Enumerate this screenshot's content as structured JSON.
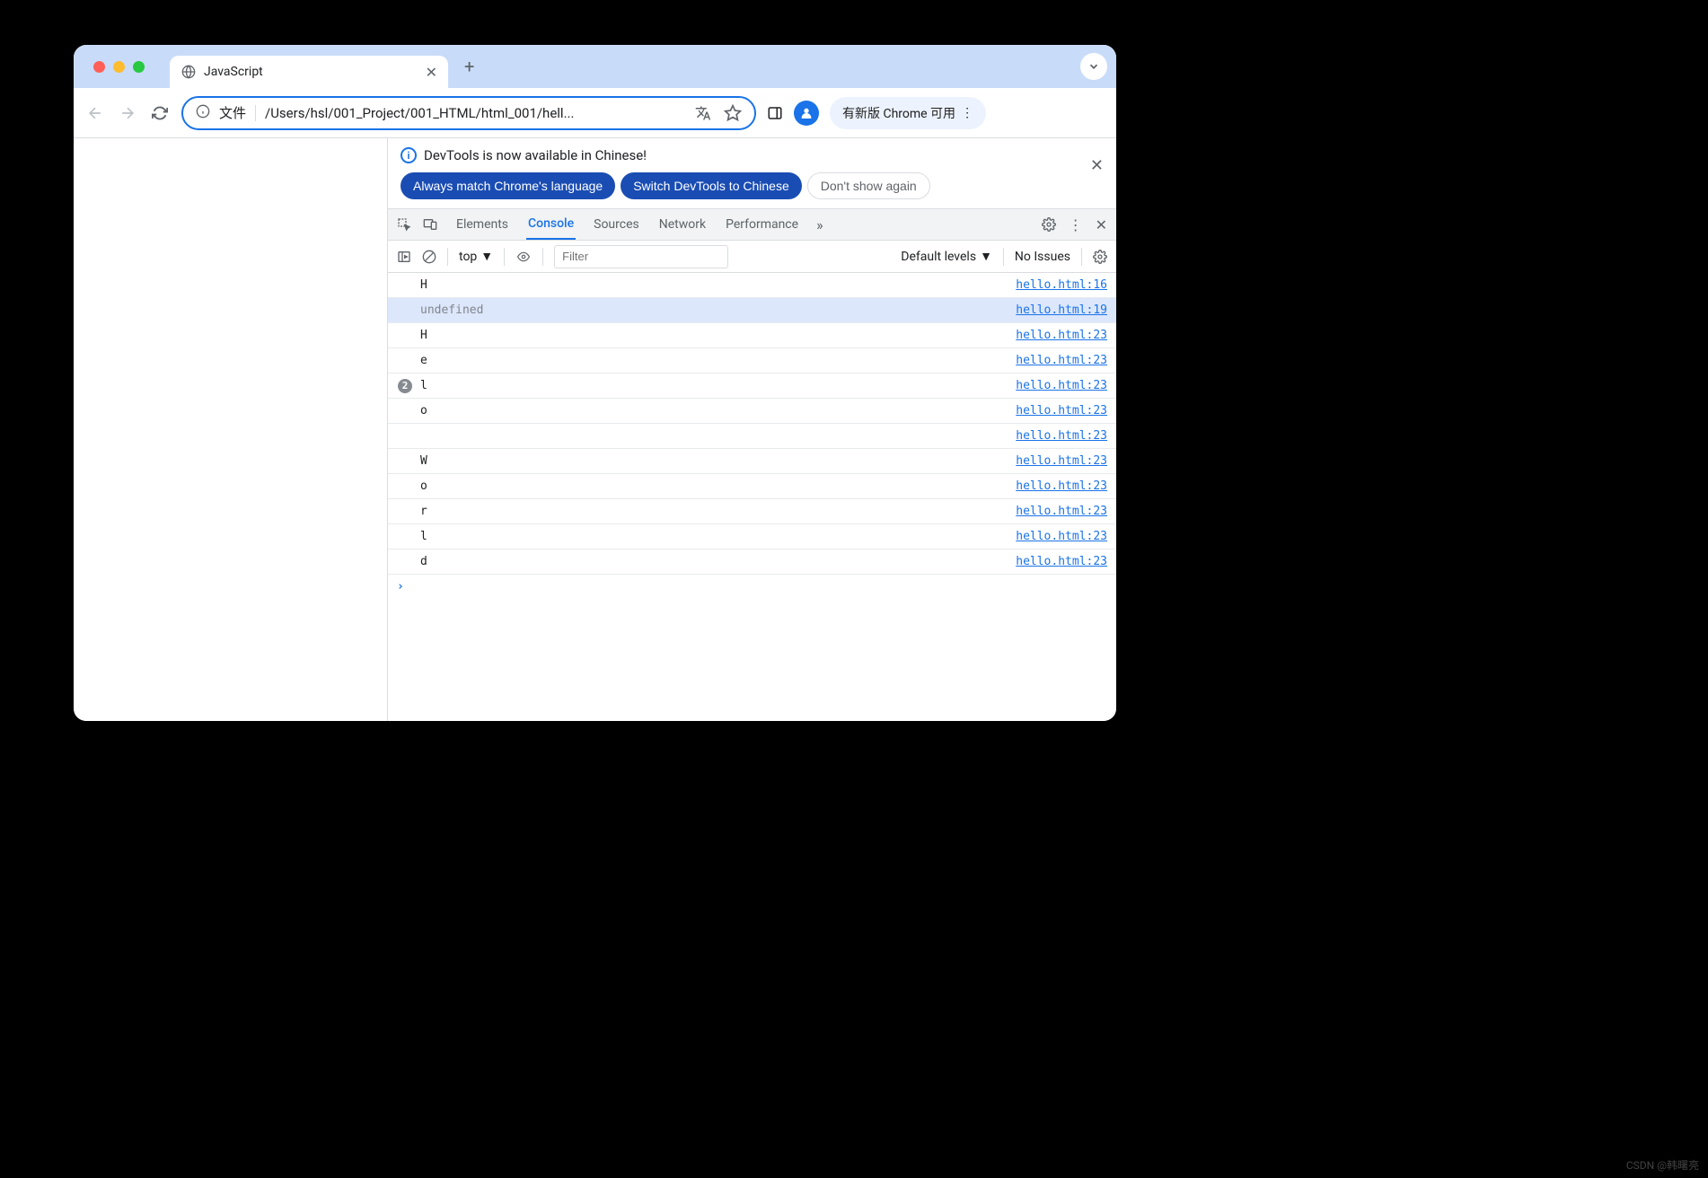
{
  "browser": {
    "tab_title": "JavaScript",
    "address": {
      "label": "文件",
      "url": "/Users/hsl/001_Project/001_HTML/html_001/hell..."
    },
    "update_label": "有新版 Chrome 可用"
  },
  "devtools": {
    "notification": {
      "text": "DevTools is now available in Chinese!",
      "btn_always": "Always match Chrome's language",
      "btn_switch": "Switch DevTools to Chinese",
      "btn_dont": "Don't show again"
    },
    "tabs": {
      "elements": "Elements",
      "console": "Console",
      "sources": "Sources",
      "network": "Network",
      "performance": "Performance"
    },
    "console_toolbar": {
      "context": "top",
      "filter_placeholder": "Filter",
      "levels": "Default levels",
      "issues": "No Issues"
    },
    "messages": [
      {
        "badge": "",
        "text": "H",
        "dim": false,
        "link": "hello.html:16",
        "hl": false
      },
      {
        "badge": "",
        "text": "undefined",
        "dim": true,
        "link": "hello.html:19",
        "hl": true
      },
      {
        "badge": "",
        "text": "H",
        "dim": false,
        "link": "hello.html:23",
        "hl": false
      },
      {
        "badge": "",
        "text": "e",
        "dim": false,
        "link": "hello.html:23",
        "hl": false
      },
      {
        "badge": "2",
        "text": "l",
        "dim": false,
        "link": "hello.html:23",
        "hl": false
      },
      {
        "badge": "",
        "text": "o",
        "dim": false,
        "link": "hello.html:23",
        "hl": false
      },
      {
        "badge": "",
        "text": "",
        "dim": false,
        "link": "hello.html:23",
        "hl": false
      },
      {
        "badge": "",
        "text": "W",
        "dim": false,
        "link": "hello.html:23",
        "hl": false
      },
      {
        "badge": "",
        "text": "o",
        "dim": false,
        "link": "hello.html:23",
        "hl": false
      },
      {
        "badge": "",
        "text": "r",
        "dim": false,
        "link": "hello.html:23",
        "hl": false
      },
      {
        "badge": "",
        "text": "l",
        "dim": false,
        "link": "hello.html:23",
        "hl": false
      },
      {
        "badge": "",
        "text": "d",
        "dim": false,
        "link": "hello.html:23",
        "hl": false
      }
    ]
  },
  "watermark": "CSDN @韩曙亮"
}
